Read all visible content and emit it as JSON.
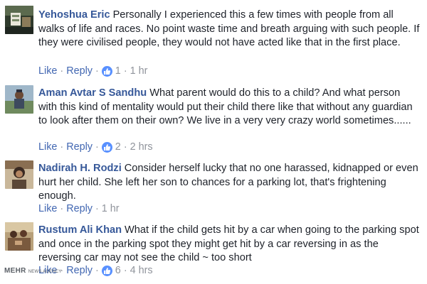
{
  "comments": [
    {
      "author": "Yehoshua Eric",
      "text": "Personally I experienced this a few times with people from all walks of life and races. No point waste time and breath arguing with such people. If they were civilised people, they would not have acted like that in the first place.",
      "like_label": "Like",
      "reply_label": "Reply",
      "reaction_count": "1",
      "time": "1 hr",
      "avatar_icon": "profile-photo-icon"
    },
    {
      "author": "Aman Avtar S Sandhu",
      "text": "What parent would do this to a child? And what person with this kind of mentality would put their child there like that without any guardian to look after them on their own? We live in a very very crazy world sometimes......",
      "like_label": "Like",
      "reply_label": "Reply",
      "reaction_count": "2",
      "time": "2 hrs",
      "avatar_icon": "profile-photo-icon"
    },
    {
      "author": "Nadirah H. Rodzi",
      "text": "Consider herself lucky that no one harassed, kidnapped or even hurt her child. She left her son to chances for a parking lot, that's frightening enough.",
      "like_label": "Like",
      "reply_label": "Reply",
      "reaction_count": "",
      "time": "1 hr",
      "avatar_icon": "profile-photo-icon"
    },
    {
      "author": "Rustum Ali Khan",
      "text": "What if the child gets hit by a car when going to the parking spot and once in the parking spot they might get hit by a car reversing in as the reversing car may not see the child ~ too short",
      "like_label": "Like",
      "reply_label": "Reply",
      "reaction_count": "6",
      "time": "4 hrs",
      "avatar_icon": "profile-photo-icon"
    }
  ],
  "separator": "·",
  "colors": {
    "author": "#365899",
    "action_link": "#4267b2",
    "meta": "#90949c",
    "text": "#1d2129",
    "like_badge": "#5890ff"
  },
  "watermark": {
    "main": "MEHR",
    "sub": "NEWS AGENCY"
  }
}
